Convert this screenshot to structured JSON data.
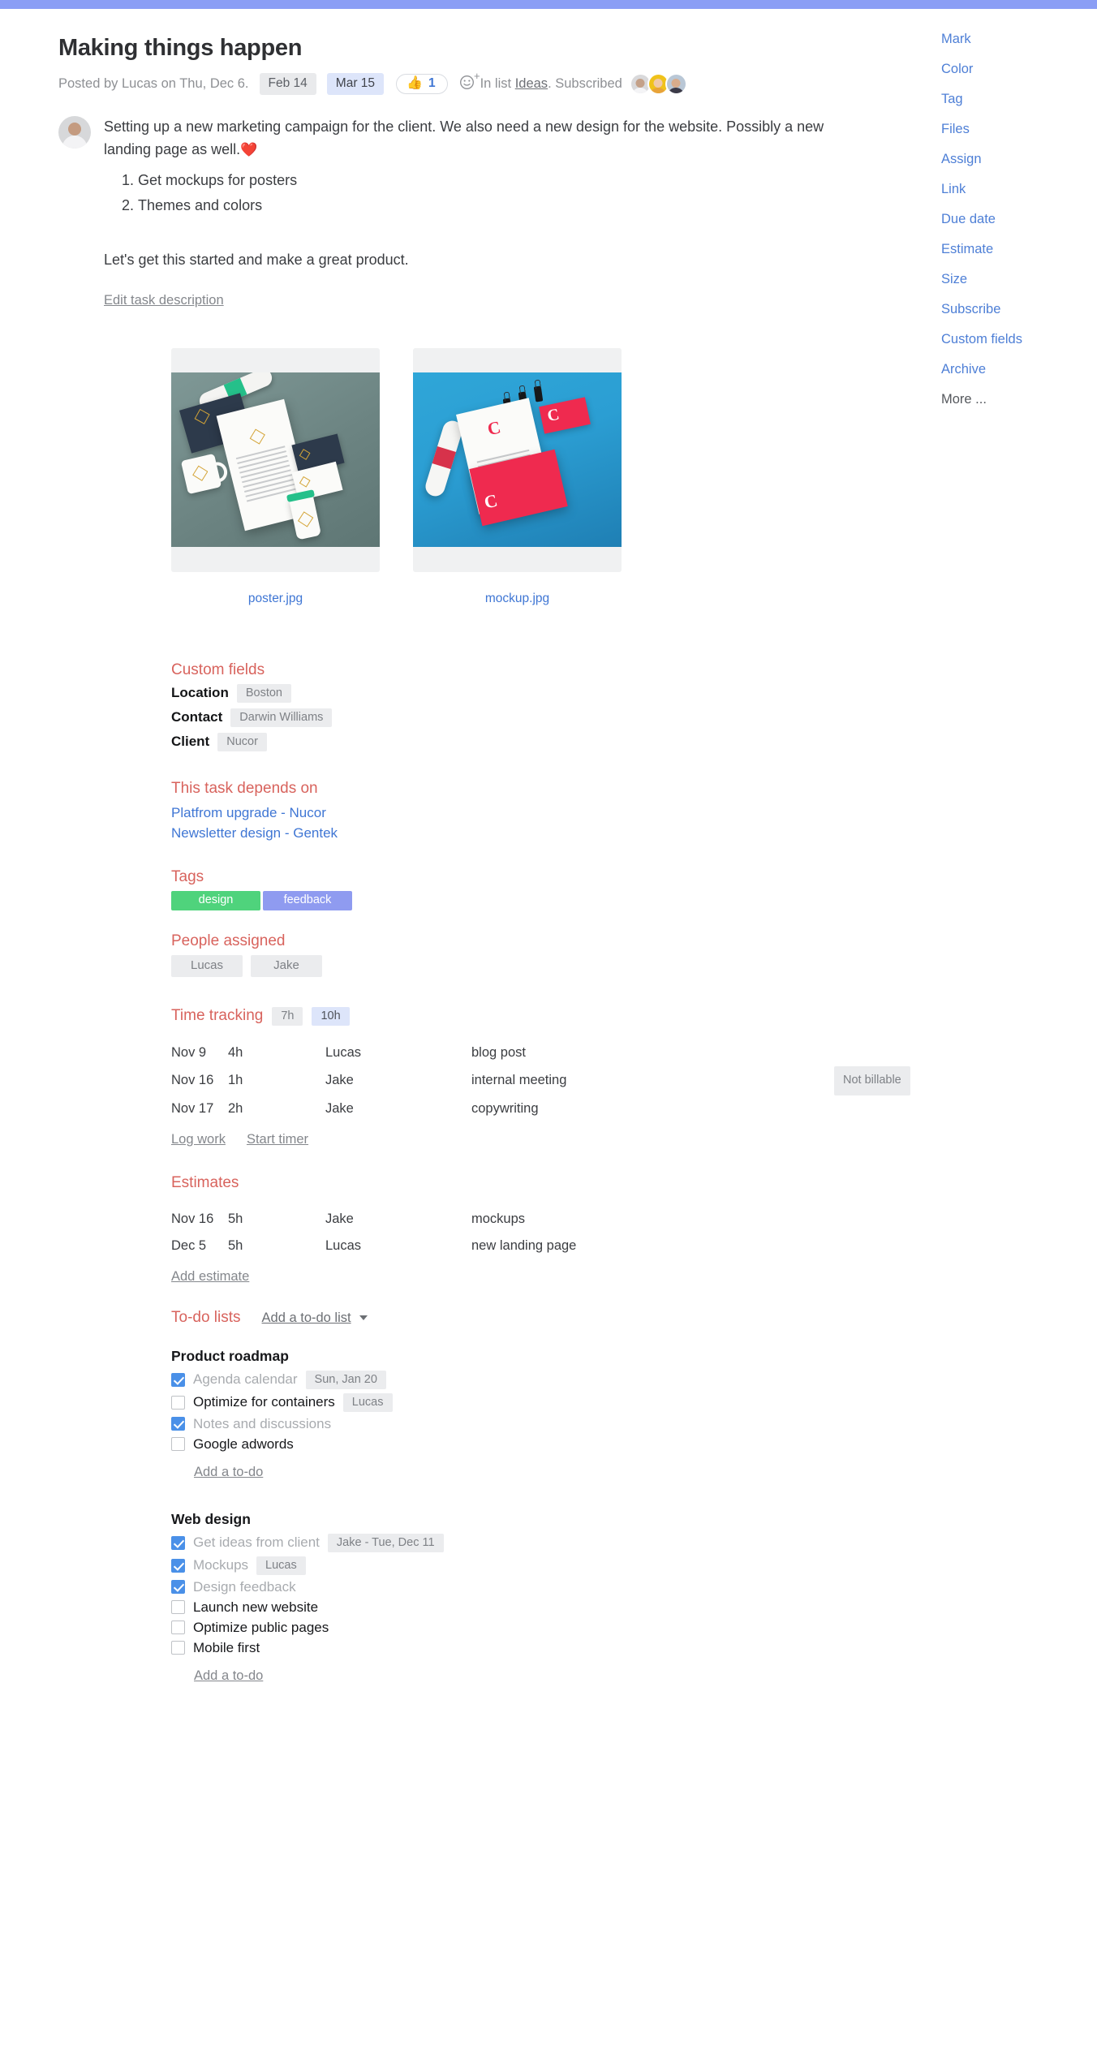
{
  "top_bar_color": "#8b9ef5",
  "header": {
    "title": "Making things happen",
    "posted_by": "Posted by Lucas on Thu, Dec 6.",
    "date_chip_1": "Feb 14",
    "date_chip_2": "Mar 15",
    "vote_icon": "thumbs-up-icon",
    "vote_count": "1",
    "add_reaction_icon": "add-reaction-icon",
    "in_list_prefix": "In list",
    "list_name": "Ideas",
    "in_list_suffix": ".",
    "subscribed": "Subscribed"
  },
  "description": {
    "paragraph_1": "Setting up a new marketing campaign for the client. We also need a new design for the website. Possibly a new landing page as well.",
    "heart_emoji": "❤️",
    "list_items": [
      "Get mockups for posters",
      "Themes and colors"
    ],
    "paragraph_2": "Let's get this started and make a great product.",
    "edit_link": "Edit task description"
  },
  "attachments": [
    {
      "name": "poster.jpg"
    },
    {
      "name": "mockup.jpg"
    }
  ],
  "custom_fields": {
    "heading": "Custom fields",
    "rows": [
      {
        "label": "Location",
        "value": "Boston"
      },
      {
        "label": "Contact",
        "value": "Darwin Williams"
      },
      {
        "label": "Client",
        "value": "Nucor"
      }
    ]
  },
  "depends_on": {
    "heading": "This task depends on",
    "links": [
      "Platfrom upgrade - Nucor",
      "Newsletter design - Gentek"
    ]
  },
  "tags": {
    "heading": "Tags",
    "items": [
      {
        "label": "design",
        "color": "#4fd37c"
      },
      {
        "label": "feedback",
        "color": "#8f9bf0"
      }
    ]
  },
  "people_assigned": {
    "heading": "People assigned",
    "items": [
      "Lucas",
      "Jake"
    ]
  },
  "time_tracking": {
    "heading": "Time tracking",
    "chip_1": "7h",
    "chip_2": "10h",
    "rows": [
      {
        "date": "Nov 9",
        "hours": "4h",
        "who": "Lucas",
        "note": "blog post",
        "flag": ""
      },
      {
        "date": "Nov 16",
        "hours": "1h",
        "who": "Jake",
        "note": "internal meeting",
        "flag": "Not billable"
      },
      {
        "date": "Nov 17",
        "hours": "2h",
        "who": "Jake",
        "note": "copywriting",
        "flag": ""
      }
    ],
    "log_work_link": "Log work",
    "start_timer_link": "Start timer"
  },
  "estimates": {
    "heading": "Estimates",
    "rows": [
      {
        "date": "Nov 16",
        "hours": "5h",
        "who": "Jake",
        "note": "mockups"
      },
      {
        "date": "Dec 5",
        "hours": "5h",
        "who": "Lucas",
        "note": "new landing page"
      }
    ],
    "add_link": "Add estimate"
  },
  "todo_lists": {
    "heading": "To-do lists",
    "add_list_label": "Add a to-do list",
    "groups": [
      {
        "title": "Product roadmap",
        "items": [
          {
            "label": "Agenda calendar",
            "checked": true,
            "chip": "Sun, Jan 20"
          },
          {
            "label": "Optimize for containers",
            "checked": false,
            "chip": "Lucas"
          },
          {
            "label": "Notes and discussions",
            "checked": true,
            "chip": ""
          },
          {
            "label": "Google adwords",
            "checked": false,
            "chip": ""
          }
        ],
        "add_todo_label": "Add a to-do"
      },
      {
        "title": "Web design",
        "items": [
          {
            "label": "Get ideas from client",
            "checked": true,
            "chip": "Jake - Tue, Dec 11"
          },
          {
            "label": "Mockups",
            "checked": true,
            "chip": "Lucas"
          },
          {
            "label": "Design feedback",
            "checked": true,
            "chip": ""
          },
          {
            "label": "Launch new website",
            "checked": false,
            "chip": ""
          },
          {
            "label": "Optimize public pages",
            "checked": false,
            "chip": ""
          },
          {
            "label": "Mobile first",
            "checked": false,
            "chip": ""
          }
        ],
        "add_todo_label": "Add a to-do"
      }
    ]
  },
  "sidebar": {
    "items": [
      "Mark",
      "Color",
      "Tag",
      "Files",
      "Assign",
      "Link",
      "Due date",
      "Estimate",
      "Size",
      "Subscribe",
      "Custom fields",
      "Archive",
      "More ..."
    ]
  }
}
